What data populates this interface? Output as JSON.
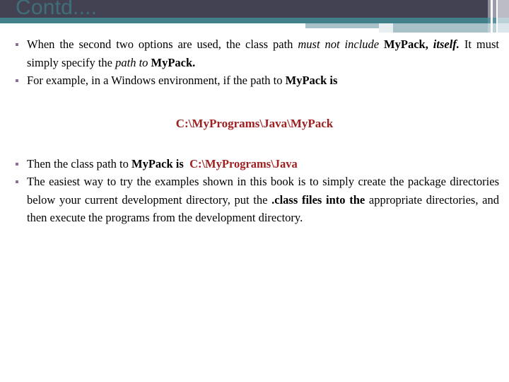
{
  "slide": {
    "title": "Contd....",
    "colors": {
      "band_dark": "#434253",
      "band_teal": "#41808a",
      "band_lightblue": "#a8c1c8",
      "bullet": "#8d6e96",
      "accent_red": "#9e2021",
      "body_text": "#000000",
      "background": "#ffffff"
    }
  },
  "bullets": {
    "b1": {
      "seg1": "When the second two options are used, the class path ",
      "seg2_italic": "must not include",
      "seg3_bold": " MyPack,",
      "seg4_bolditalic": "itself.",
      "seg5": " It must simply specify the ",
      "seg6_italic": "path to",
      "seg7_bold": " MyPack."
    },
    "b2": {
      "seg1": "For example, in a Windows environment, if the path to ",
      "seg2_bold": "MyPack is"
    },
    "b3": {
      "seg1": "Then the class path to ",
      "seg2_bold": "MyPack is",
      "seg3_red": "C:\\MyPrograms\\Java"
    },
    "b4": {
      "seg1": "The easiest way to try the examples shown in this book is to simply create the package directories below your current development directory, put the ",
      "seg2_bold": ".class files into the",
      "seg3": " appropriate directories, and then execute the programs from the development directory."
    }
  },
  "callout": {
    "path": "C:\\MyPrograms\\Java\\MyPack"
  }
}
